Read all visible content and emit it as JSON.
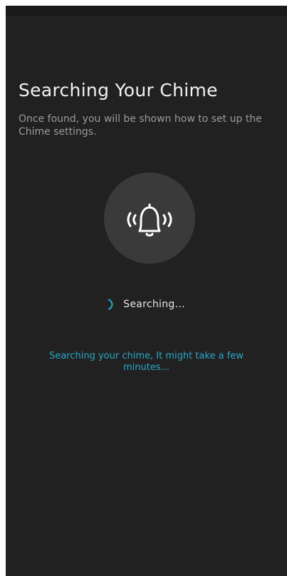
{
  "screen": {
    "title": "Searching Your Chime",
    "subtitle": "Once found, you will be shown how to set up the Chime settings.",
    "status_text": "Searching...",
    "hint": "Searching your chime, It might take a few minutes...",
    "icons": {
      "main": "bell-ringing-icon",
      "spinner": "loading-spinner-icon"
    },
    "colors": {
      "background": "#212121",
      "icon_circle": "#3a3a3a",
      "accent": "#2aa8c9",
      "title": "#f2f2f2",
      "subtitle": "#9a9a9a"
    }
  }
}
